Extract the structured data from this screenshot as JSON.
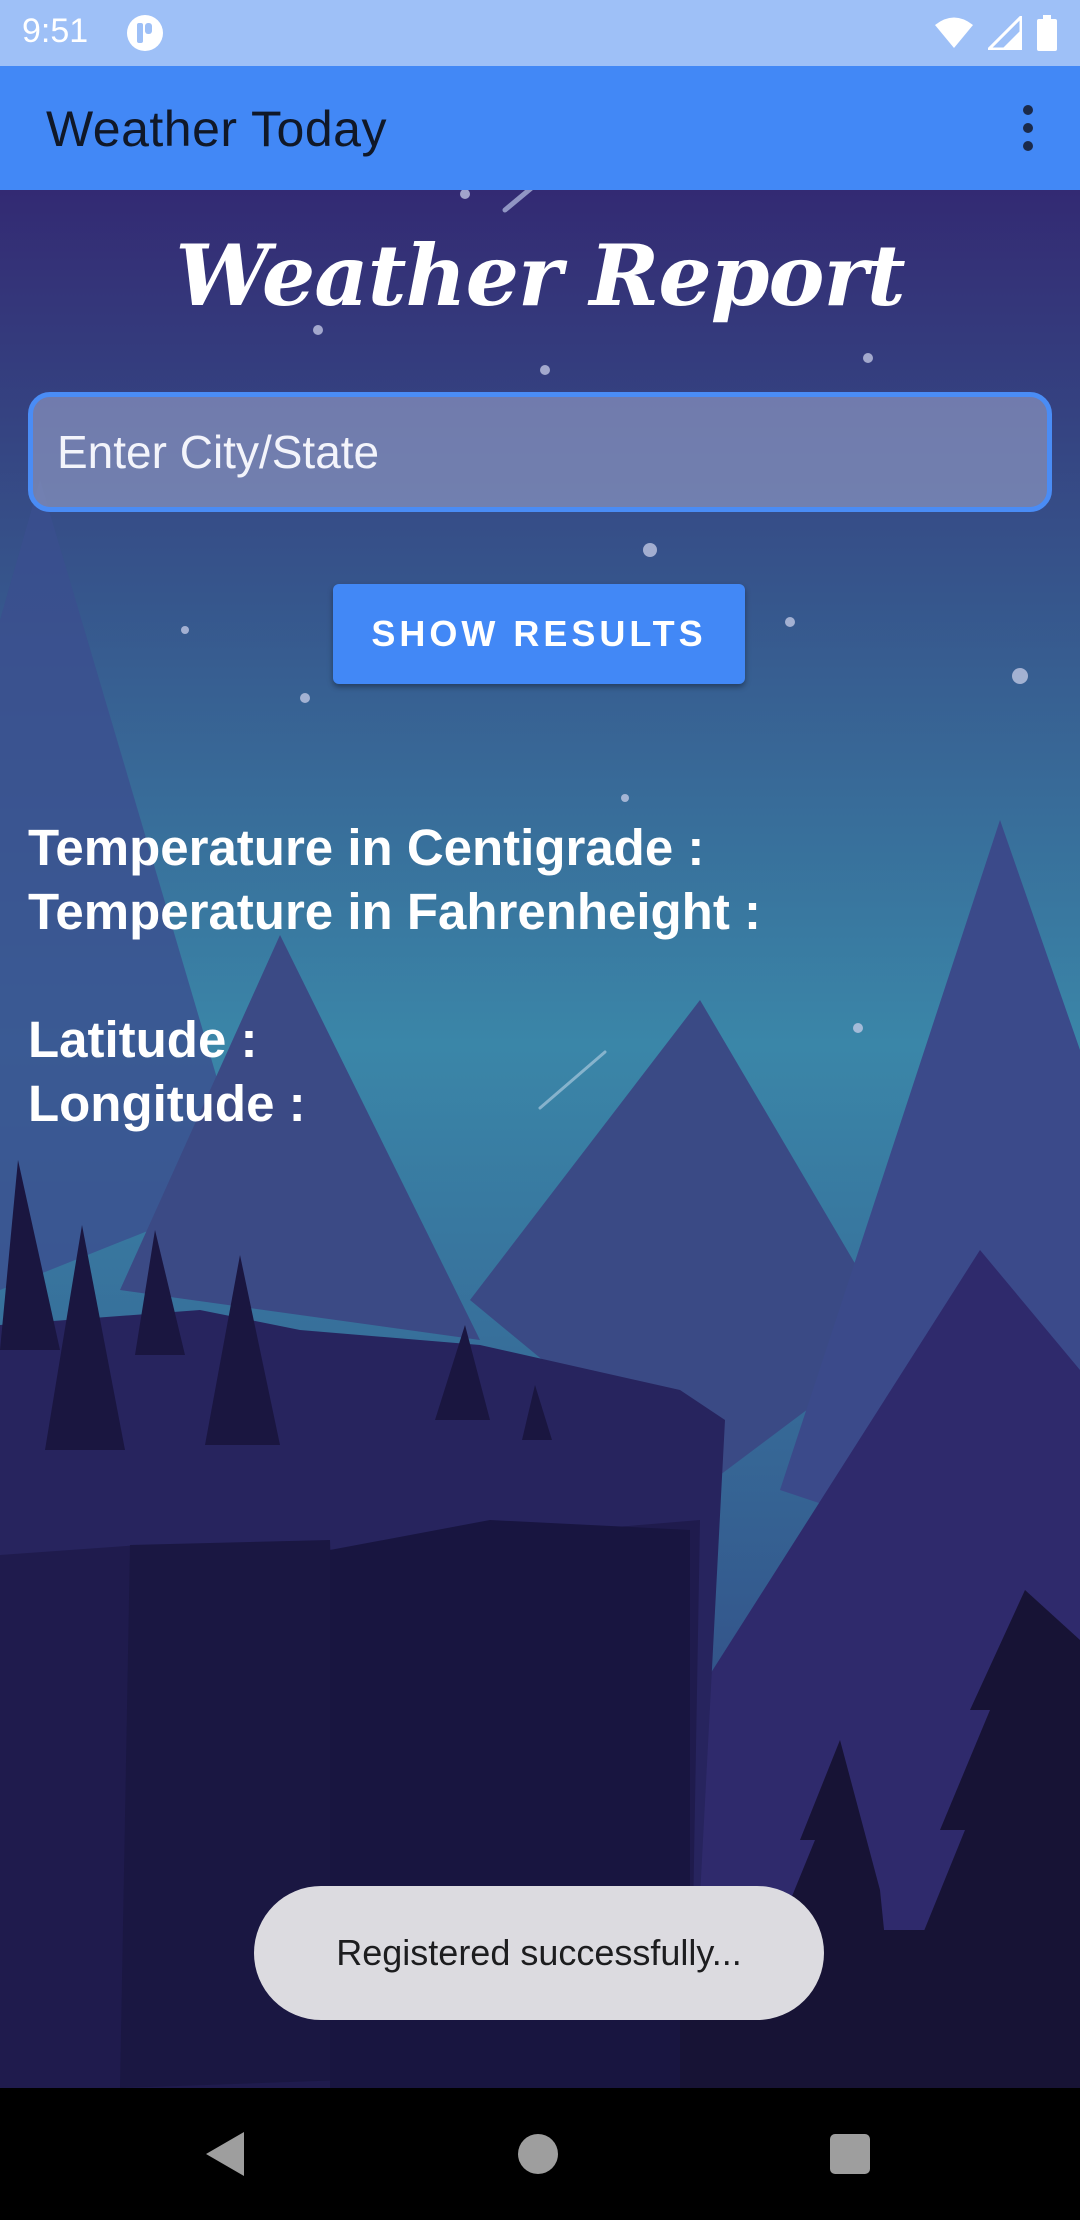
{
  "status_bar": {
    "time": "9:51",
    "background": "#9ec0f7",
    "icons": [
      "app-notification-icon",
      "wifi-icon",
      "cell-signal-icon",
      "battery-icon"
    ]
  },
  "app_bar": {
    "title": "Weather Today",
    "background": "#4288f6",
    "menu_icon": "more-vert-icon"
  },
  "main": {
    "report_title": "Weather Report",
    "city_input": {
      "placeholder": "Enter City/State",
      "value": ""
    },
    "show_button_label": "SHOW RESULTS",
    "labels": {
      "temp_c": "Temperature in Centigrade :",
      "temp_f": "Temperature in Fahrenheight :",
      "latitude": "Latitude :",
      "longitude": "Longitude :"
    }
  },
  "toast": {
    "message": "Registered successfully..."
  },
  "nav_bar": {
    "icons": [
      "back-icon",
      "home-icon",
      "recents-icon"
    ]
  },
  "colors": {
    "accent": "#4288f6",
    "sky_top": "#332a73",
    "sky_mid": "#3a86a8"
  }
}
